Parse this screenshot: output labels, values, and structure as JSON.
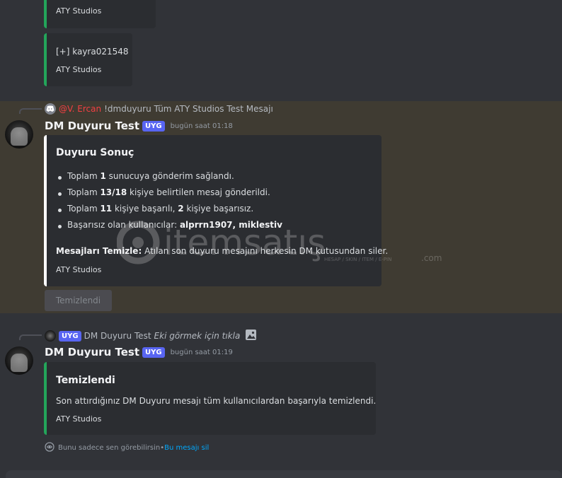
{
  "top_embeds": [
    {
      "footer": "ATY Studios"
    },
    {
      "text": "[+] kayra021548",
      "footer": "ATY Studios"
    }
  ],
  "message1": {
    "reply": {
      "mention": "@V. Ercan",
      "text": "!dmduyuru Tüm ATY Studios Test Mesajı"
    },
    "username": "DM Duyuru Test",
    "badge": "UYG",
    "timestamp": "bugün saat 01:18",
    "embed": {
      "title": "Duyuru Sonuç",
      "bullets": [
        {
          "pre": "Toplam ",
          "b1": "1",
          "mid": " sunucuya gönderim sağlandı.",
          "b2": "",
          "post": ""
        },
        {
          "pre": "Toplam ",
          "b1": "13/18",
          "mid": " kişiye belirtilen mesaj gönderildi.",
          "b2": "",
          "post": ""
        },
        {
          "pre": "Toplam ",
          "b1": "11",
          "mid": " kişiye başarılı, ",
          "b2": "2",
          "post": " kişiye başarısız."
        },
        {
          "pre": "Başarısız olan kullanıcılar: ",
          "b1": "alprrn1907, miklestiv",
          "mid": "",
          "b2": "",
          "post": ""
        }
      ],
      "clean_label": "Mesajları Temizle:",
      "clean_text": " Atılan son duyuru mesajını herkesin DM kutusundan siler.",
      "footer": "ATY Studios"
    },
    "button_label": "Temizlendi"
  },
  "message2": {
    "reply": {
      "badge": "UYG",
      "name": "DM Duyuru Test",
      "text": "Eki görmek için tıkla"
    },
    "username": "DM Duyuru Test",
    "badge": "UYG",
    "timestamp": "bugün saat 01:19",
    "embed": {
      "title": "Temizlendi",
      "text": "Son attırdığınız DM Duyuru mesajı tüm kullanıcılardan başarıyla temizlendi.",
      "footer": "ATY Studios"
    },
    "ephemeral": {
      "text": "Bunu sadece sen görebilirsin",
      "sep": " • ",
      "link": "Bu mesajı sil"
    }
  },
  "watermark": {
    "brand": "itemsatış",
    "tagline": "HESAP / SKIN / ITEM / E-PIN",
    "suffix": ".com"
  },
  "colors": {
    "accent_green": "#23a55a",
    "accent_white": "#ffffff",
    "badge": "#5865f2",
    "highlight": "#3f3b32",
    "link": "#00a8fc",
    "mention": "#f23f42"
  }
}
